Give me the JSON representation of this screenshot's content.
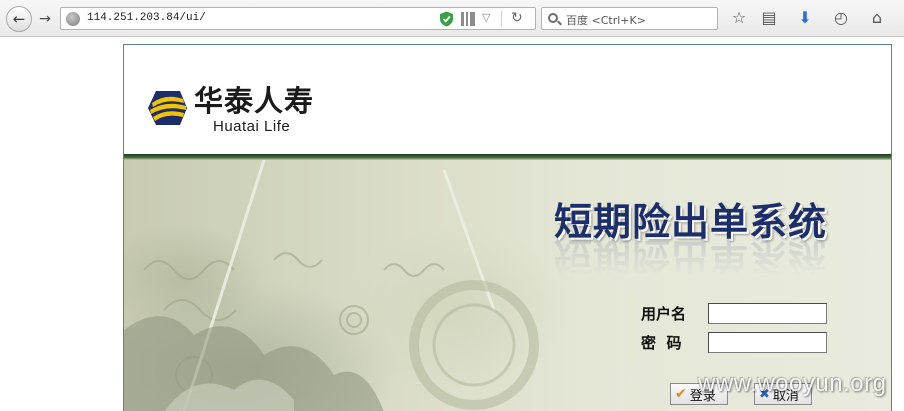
{
  "browser": {
    "url": "114.251.203.84/ui/",
    "search_placeholder": "百度 <Ctrl+K>",
    "icons": [
      "back-icon",
      "forward-icon",
      "globe-icon",
      "shield-icon",
      "qr-code-icon",
      "dropdown-icon",
      "reload-icon",
      "search-icon",
      "bookmark-star-icon",
      "reading-list-icon",
      "download-icon",
      "history-icon",
      "home-icon"
    ]
  },
  "logo": {
    "cn": "华泰人寿",
    "en": "Huatai Life"
  },
  "banner": {
    "title": "短期险出单系统"
  },
  "form": {
    "username_label": "用户名",
    "password_label": "密  码",
    "username_value": "",
    "password_value": "",
    "login_label": "登录",
    "cancel_label": "取消"
  },
  "watermark": "www.wooyun.org",
  "colors": {
    "title_blue": "#1c2f6b",
    "header_green": "#2b4a25",
    "logo_yellow": "#f2c400",
    "logo_navy": "#1d2d6b"
  }
}
